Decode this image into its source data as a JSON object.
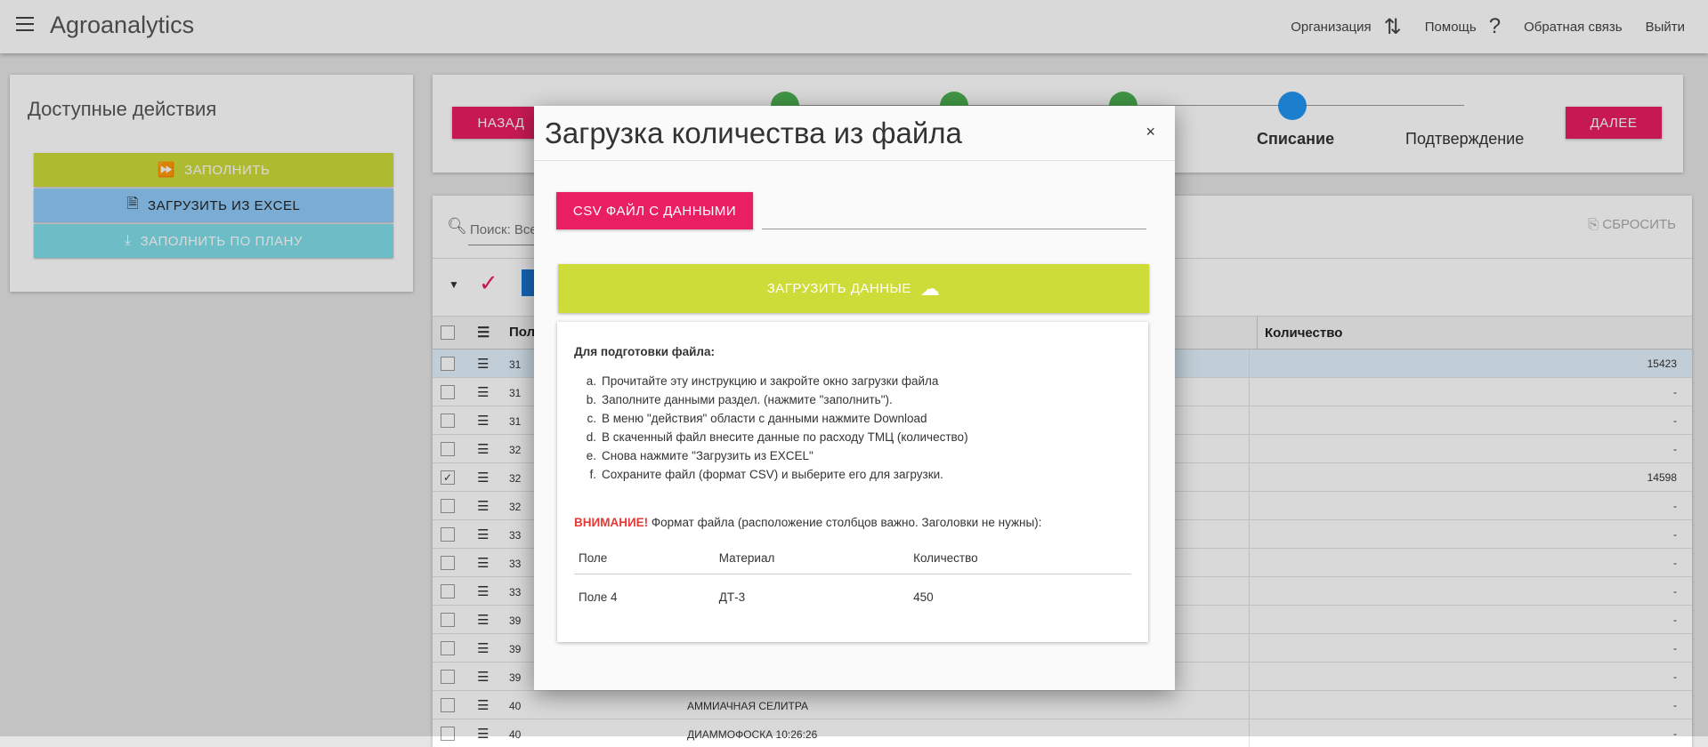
{
  "app": {
    "title": "Agroanalytics"
  },
  "topnav": {
    "org": "Организация",
    "help": "Помощь",
    "feedback": "Обратная связь",
    "logout": "Выйти"
  },
  "actions": {
    "title": "Доступные действия",
    "fill": "ЗАПОЛНИТЬ",
    "excel": "ЗАГРУЗИТЬ ИЗ EXCEL",
    "plan": "ЗАПОЛНИТЬ ПО ПЛАНУ"
  },
  "stepper": {
    "back": "НАЗАД",
    "next": "ДАЛЕЕ",
    "steps": [
      {
        "label": "",
        "state": "done"
      },
      {
        "label": "",
        "state": "done"
      },
      {
        "label": "",
        "state": "done"
      },
      {
        "label": "Списание",
        "state": "active"
      },
      {
        "label": "Подтверждение",
        "state": "pending"
      }
    ]
  },
  "table": {
    "search_placeholder": "Поиск: Все",
    "reset": "СБРОСИТЬ",
    "col1_header": "Пол",
    "qty_header": "Количество",
    "rows": [
      {
        "c1": "31",
        "mat": "",
        "qty": "15423",
        "checked": false,
        "selected": true
      },
      {
        "c1": "31",
        "mat": "",
        "qty": "-",
        "checked": false,
        "selected": false
      },
      {
        "c1": "31",
        "mat": "",
        "qty": "-",
        "checked": false,
        "selected": false
      },
      {
        "c1": "32",
        "mat": "",
        "qty": "-",
        "checked": false,
        "selected": false
      },
      {
        "c1": "32",
        "mat": "",
        "qty": "14598",
        "checked": true,
        "selected": false
      },
      {
        "c1": "32",
        "mat": "",
        "qty": "-",
        "checked": false,
        "selected": false
      },
      {
        "c1": "33",
        "mat": "",
        "qty": "-",
        "checked": false,
        "selected": false
      },
      {
        "c1": "33",
        "mat": "",
        "qty": "-",
        "checked": false,
        "selected": false
      },
      {
        "c1": "33",
        "mat": "",
        "qty": "-",
        "checked": false,
        "selected": false
      },
      {
        "c1": "39",
        "mat": "",
        "qty": "-",
        "checked": false,
        "selected": false
      },
      {
        "c1": "39",
        "mat": "",
        "qty": "-",
        "checked": false,
        "selected": false
      },
      {
        "c1": "39",
        "mat": "",
        "qty": "-",
        "checked": false,
        "selected": false
      },
      {
        "c1": "40",
        "mat": "АММИАЧНАЯ СЕЛИТРА",
        "qty": "-",
        "checked": false,
        "selected": false
      },
      {
        "c1": "40",
        "mat": "ДИАММОФОСКА 10:26:26",
        "qty": "-",
        "checked": false,
        "selected": false
      }
    ]
  },
  "modal": {
    "title": "Загрузка количества из файла",
    "close": "×",
    "csv_button": "CSV ФАЙЛ С ДАННЫМИ",
    "upload_button": "ЗАГРУЗИТЬ ДАННЫЕ",
    "instr_heading": "Для подготовки файла:",
    "steps": [
      {
        "marker": "a.",
        "text": "Прочитайте эту инструкцию и закройте окно загрузки файла"
      },
      {
        "marker": "b.",
        "text": "Заполните данными раздел. (нажмите \"заполнить\")."
      },
      {
        "marker": "c.",
        "text": "В меню \"действия\" области с данными нажмите Download"
      },
      {
        "marker": "d.",
        "text": "В скаченный файл внесите данные по расходу ТМЦ (количество)"
      },
      {
        "marker": "e.",
        "text": "Снова нажмите \"Загрузить из EXCEL\""
      },
      {
        "marker": "f.",
        "text": "Сохраните файл (формат CSV) и выберите его для загрузки."
      }
    ],
    "warning_label": "ВНИМАНИЕ!",
    "warning_text": " Формат файла (расположение столбцов важно. Заголовки не нужны):",
    "example": {
      "headers": [
        "Поле",
        "Материал",
        "Количество"
      ],
      "row": [
        "Поле 4",
        "ДТ-3",
        "450"
      ]
    }
  },
  "colors": {
    "pink": "#e91e63",
    "lime": "#cddc39",
    "blue": "#90caf9",
    "cyan": "#80deea",
    "green": "#4caf50",
    "stepActive": "#2196f3"
  }
}
